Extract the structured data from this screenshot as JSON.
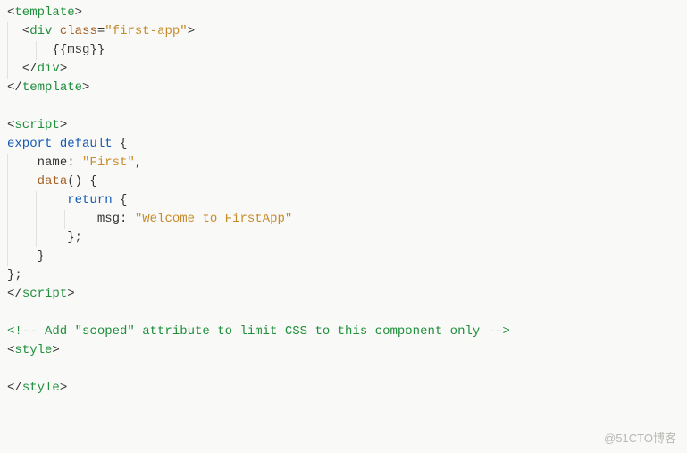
{
  "code": {
    "lines": [
      {
        "indent": 0,
        "segments": [
          {
            "cls": "punc",
            "t": "<"
          },
          {
            "cls": "tag",
            "t": "template"
          },
          {
            "cls": "punc",
            "t": ">"
          }
        ]
      },
      {
        "indent": 2,
        "guides": [
          0
        ],
        "segments": [
          {
            "cls": "punc",
            "t": "<"
          },
          {
            "cls": "tag",
            "t": "div"
          },
          {
            "cls": "plain",
            "t": " "
          },
          {
            "cls": "attr",
            "t": "class"
          },
          {
            "cls": "punc",
            "t": "="
          },
          {
            "cls": "string",
            "t": "\"first-app\""
          },
          {
            "cls": "punc",
            "t": ">"
          }
        ]
      },
      {
        "indent": 6,
        "guides": [
          0,
          4
        ],
        "segments": [
          {
            "cls": "plain",
            "t": "{{msg}}"
          }
        ]
      },
      {
        "indent": 2,
        "guides": [
          0
        ],
        "segments": [
          {
            "cls": "punc",
            "t": "</"
          },
          {
            "cls": "tag",
            "t": "div"
          },
          {
            "cls": "punc",
            "t": ">"
          }
        ]
      },
      {
        "indent": 0,
        "segments": [
          {
            "cls": "punc",
            "t": "</"
          },
          {
            "cls": "tag",
            "t": "template"
          },
          {
            "cls": "punc",
            "t": ">"
          }
        ]
      },
      {
        "indent": 0,
        "segments": []
      },
      {
        "indent": 0,
        "segments": [
          {
            "cls": "punc",
            "t": "<"
          },
          {
            "cls": "tag",
            "t": "script"
          },
          {
            "cls": "punc",
            "t": ">"
          }
        ]
      },
      {
        "indent": 0,
        "segments": [
          {
            "cls": "kw",
            "t": "export"
          },
          {
            "cls": "plain",
            "t": " "
          },
          {
            "cls": "kw",
            "t": "default"
          },
          {
            "cls": "plain",
            "t": " {"
          }
        ]
      },
      {
        "indent": 4,
        "guides": [
          0
        ],
        "segments": [
          {
            "cls": "plain",
            "t": "name: "
          },
          {
            "cls": "string",
            "t": "\"First\""
          },
          {
            "cls": "plain",
            "t": ","
          }
        ]
      },
      {
        "indent": 4,
        "guides": [
          0
        ],
        "segments": [
          {
            "cls": "attr",
            "t": "data"
          },
          {
            "cls": "plain",
            "t": "() {"
          }
        ]
      },
      {
        "indent": 8,
        "guides": [
          0,
          4
        ],
        "segments": [
          {
            "cls": "kw",
            "t": "return"
          },
          {
            "cls": "plain",
            "t": " {"
          }
        ]
      },
      {
        "indent": 12,
        "guides": [
          0,
          4,
          8
        ],
        "segments": [
          {
            "cls": "plain",
            "t": "msg: "
          },
          {
            "cls": "string",
            "t": "\"Welcome to FirstApp\""
          }
        ]
      },
      {
        "indent": 8,
        "guides": [
          0,
          4
        ],
        "segments": [
          {
            "cls": "plain",
            "t": "};"
          }
        ]
      },
      {
        "indent": 4,
        "guides": [
          0
        ],
        "segments": [
          {
            "cls": "plain",
            "t": "}"
          }
        ]
      },
      {
        "indent": 0,
        "segments": [
          {
            "cls": "plain",
            "t": "};"
          }
        ]
      },
      {
        "indent": 0,
        "segments": [
          {
            "cls": "punc",
            "t": "</"
          },
          {
            "cls": "tag",
            "t": "script"
          },
          {
            "cls": "punc",
            "t": ">"
          }
        ]
      },
      {
        "indent": 0,
        "segments": []
      },
      {
        "indent": 0,
        "segments": [
          {
            "cls": "comment",
            "t": "<!-- Add \"scoped\" attribute to limit CSS to this component only -->"
          }
        ]
      },
      {
        "indent": 0,
        "segments": [
          {
            "cls": "punc",
            "t": "<"
          },
          {
            "cls": "tag",
            "t": "style"
          },
          {
            "cls": "punc",
            "t": ">"
          }
        ]
      },
      {
        "indent": 0,
        "segments": []
      },
      {
        "indent": 0,
        "segments": [
          {
            "cls": "punc",
            "t": "</"
          },
          {
            "cls": "tag",
            "t": "style"
          },
          {
            "cls": "punc",
            "t": ">"
          }
        ]
      }
    ]
  },
  "watermark": "@51CTO博客",
  "metrics": {
    "charWidthPx": 8,
    "lineHeightPx": 21,
    "containerPadLeft": 8
  }
}
